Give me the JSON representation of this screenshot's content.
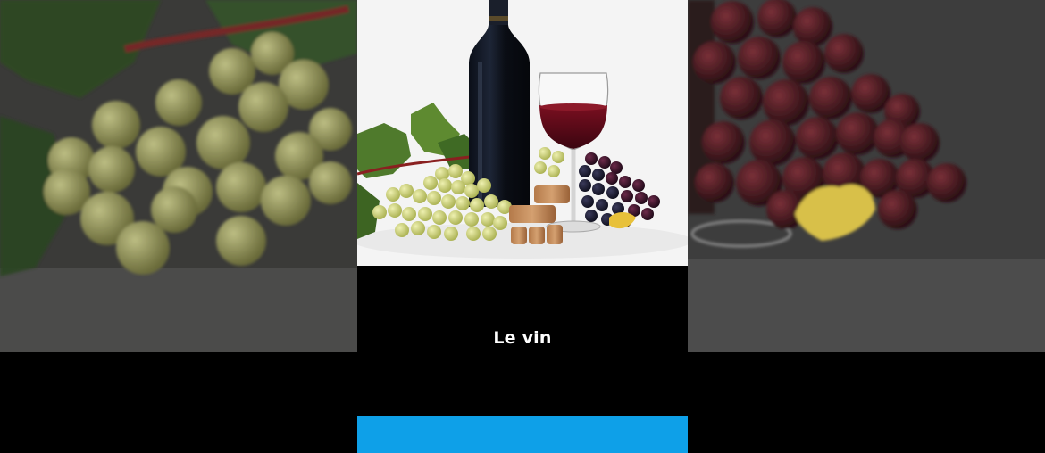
{
  "caption": {
    "text": "Le vin"
  },
  "colors": {
    "accent_bar": "#0ea0e8",
    "background": "#000000",
    "photo_bg": "#f4f4f4"
  },
  "image": {
    "subject": "wine-bottle-glass-grapes-corks"
  }
}
